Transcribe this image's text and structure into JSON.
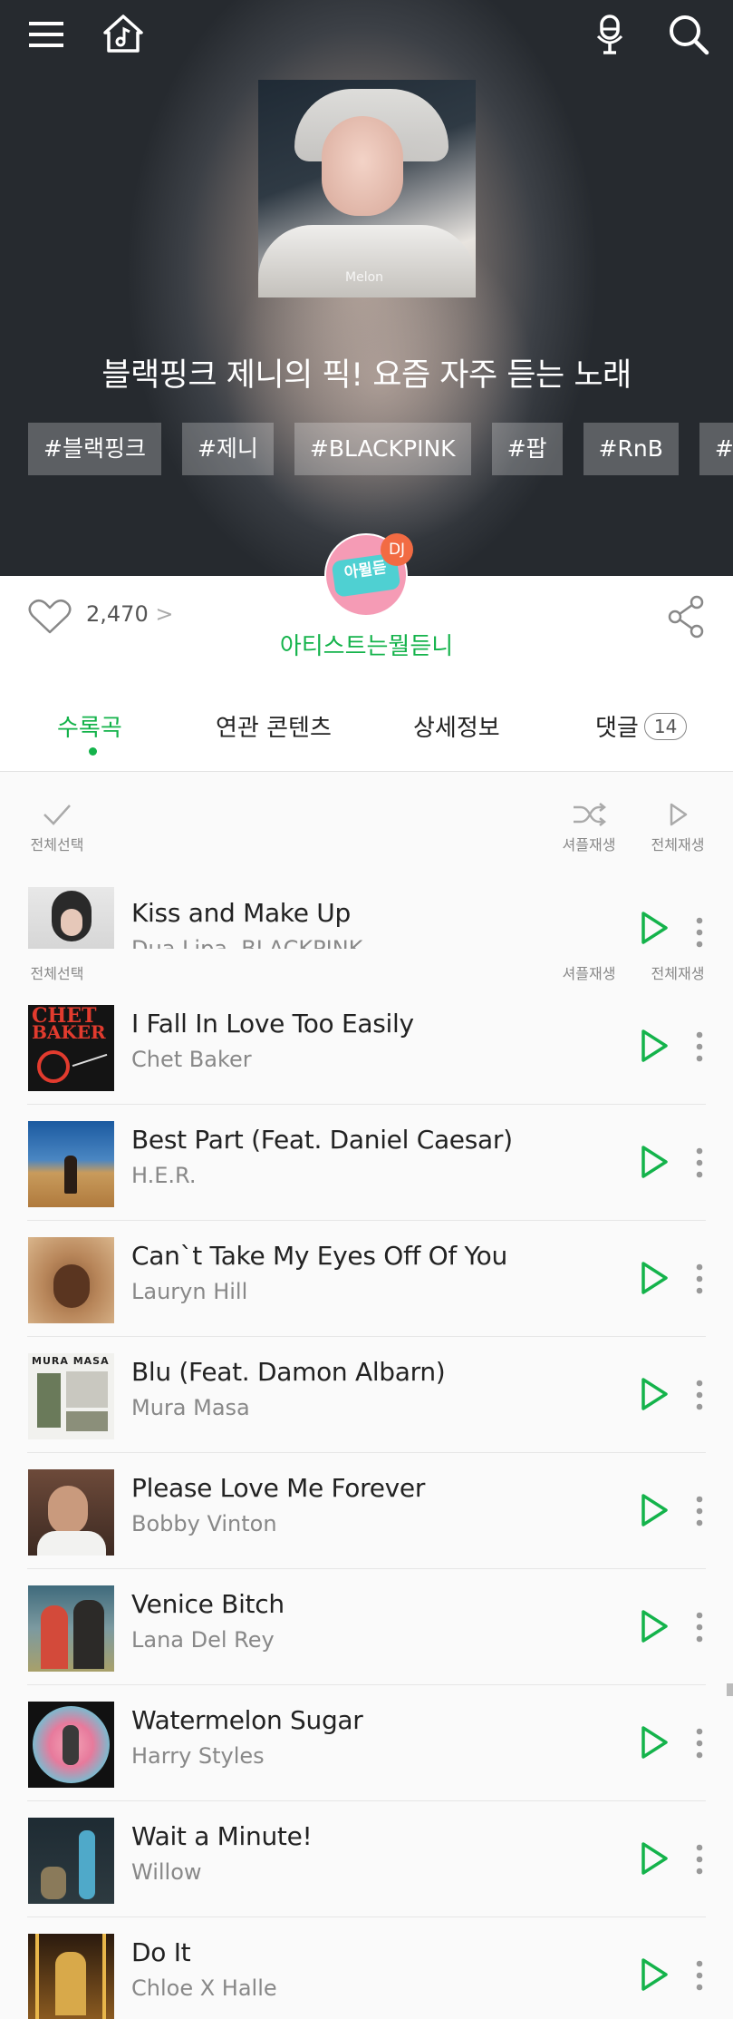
{
  "playlist": {
    "title": "블랙핑크 제니의 픽! 요즘 자주 듣는 노래",
    "tags": [
      "#블랙핑크",
      "#제니",
      "#BLACKPINK",
      "#팝",
      "#RnB",
      "#sou"
    ],
    "cover_watermark": "Melon",
    "like_count": "2,470",
    "like_chevron": ">"
  },
  "dj": {
    "badge": "DJ",
    "logo_text": "아뮐듣",
    "name": "아티스트는뭘듣니"
  },
  "tabs": [
    {
      "label": "수록곡"
    },
    {
      "label": "연관 콘텐츠"
    },
    {
      "label": "상세정보"
    },
    {
      "label": "댓글",
      "count": "14"
    }
  ],
  "controls": {
    "select_all": "전체선택",
    "shuffle": "셔플재생",
    "play_all": "전체재생"
  },
  "tracks": [
    {
      "title": "Kiss and Make Up",
      "artist": "Dua Lipa, BLACKPINK"
    },
    {
      "title": "I Fall In Love Too Easily",
      "artist": "Chet Baker"
    },
    {
      "title": "Best Part (Feat. Daniel Caesar)",
      "artist": "H.E.R."
    },
    {
      "title": "Can`t Take My Eyes Off Of You",
      "artist": "Lauryn Hill"
    },
    {
      "title": "Blu (Feat. Damon Albarn)",
      "artist": "Mura Masa"
    },
    {
      "title": "Please Love Me Forever",
      "artist": "Bobby Vinton"
    },
    {
      "title": "Venice Bitch",
      "artist": "Lana Del Rey"
    },
    {
      "title": "Watermelon Sugar",
      "artist": "Harry Styles"
    },
    {
      "title": "Wait a Minute!",
      "artist": "Willow"
    },
    {
      "title": "Do It",
      "artist": "Chloe X Halle"
    }
  ],
  "thumb_text": {
    "chet_line1": "CHET",
    "chet_line2": "BAKER",
    "mura_label": "MURA MASA"
  },
  "colors": {
    "accent": "#14b34b",
    "dj_bg": "#f59bb5",
    "dj_badge": "#f26b43",
    "dj_logo": "#4fd0d2"
  }
}
